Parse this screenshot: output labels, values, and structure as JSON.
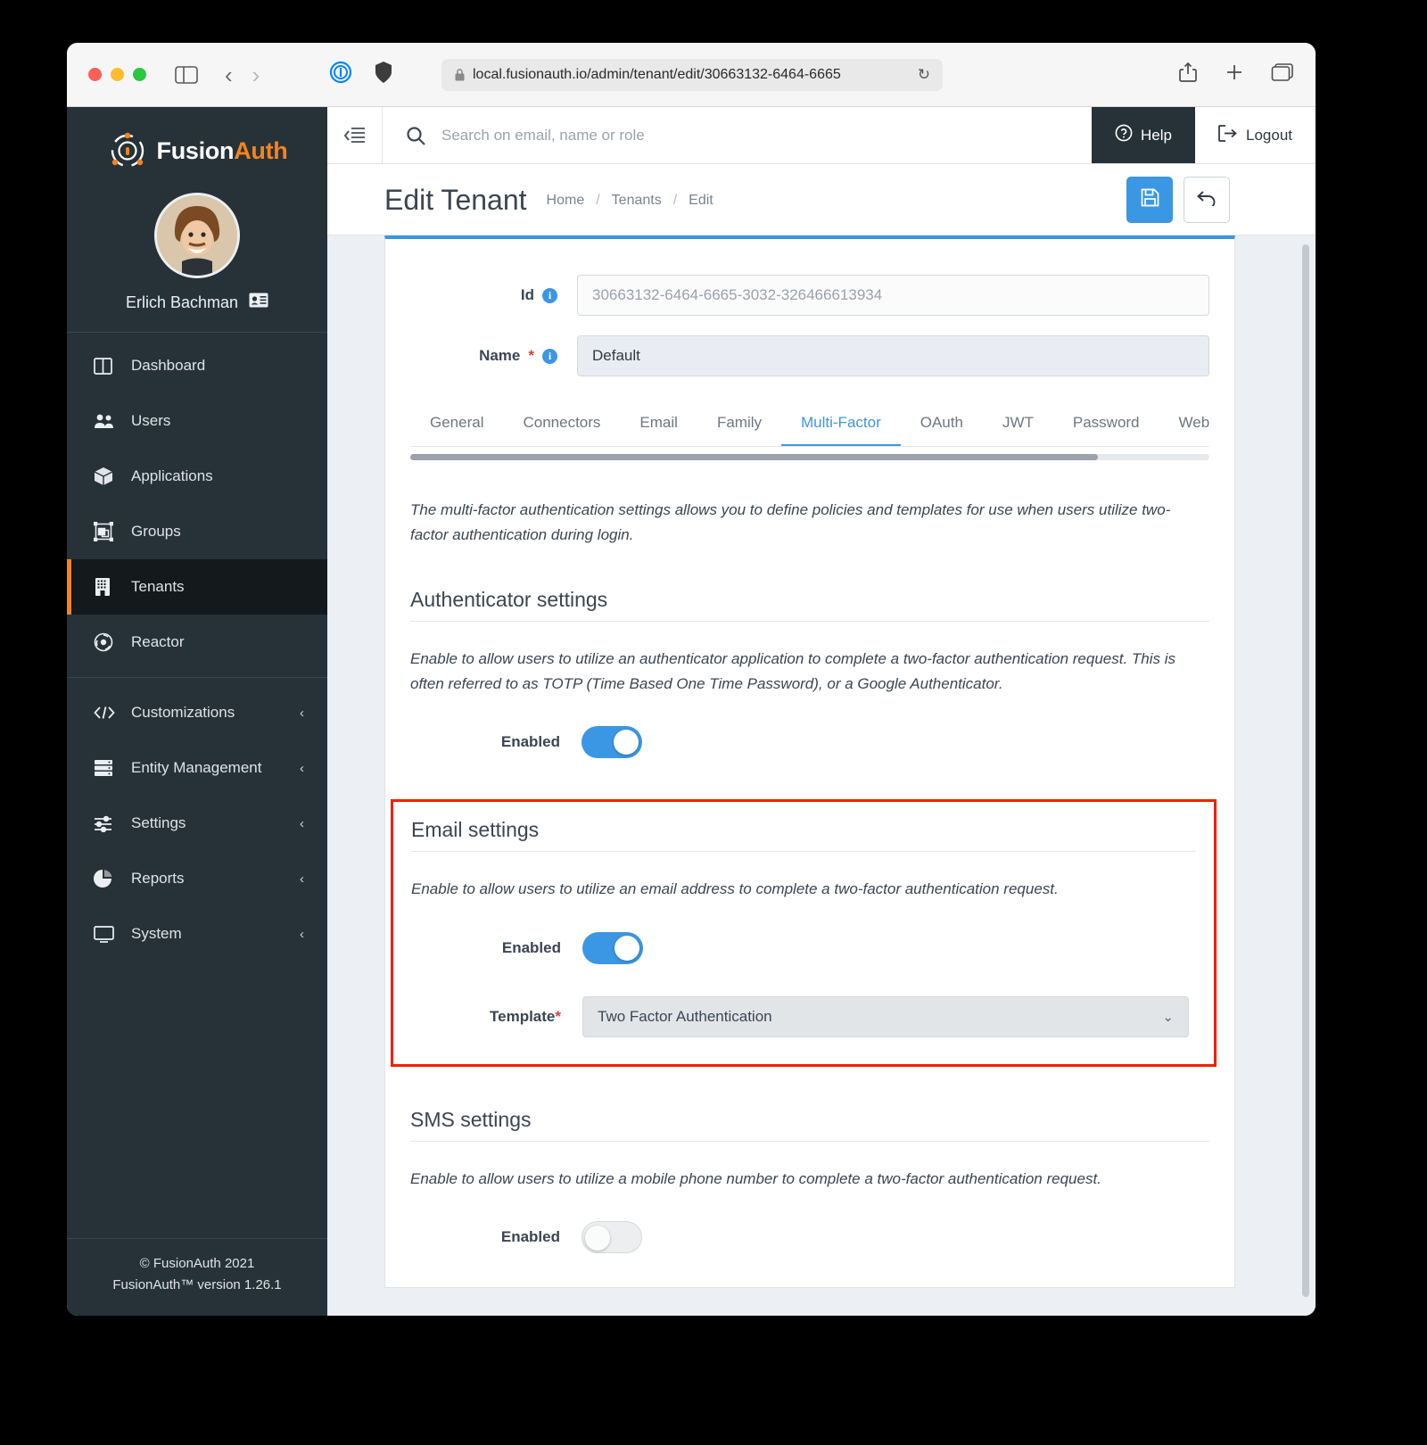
{
  "browser": {
    "url": "local.fusionauth.io/admin/tenant/edit/30663132-6464-6665",
    "lock_icon": "lock-icon",
    "reload_icon": "reload-icon",
    "share_icon": "share-icon",
    "newtab_icon": "plus-icon",
    "tabs_icon": "tabs-overview-icon",
    "back_icon": "chevron-left-icon",
    "forward_icon": "chevron-right-icon",
    "sidebar_icon": "sidebar-toggle-icon",
    "ext_1_icon": "1password-icon",
    "ext_2_icon": "shield-icon"
  },
  "sidebar": {
    "brand": {
      "first": "Fusion",
      "second": "Auth"
    },
    "user": {
      "name": "Erlich Bachman",
      "badge_icon": "id-card-icon"
    },
    "items": [
      {
        "label": "Dashboard",
        "icon": "dashboard-icon",
        "active": false,
        "chevron": ""
      },
      {
        "label": "Users",
        "icon": "users-icon",
        "active": false,
        "chevron": ""
      },
      {
        "label": "Applications",
        "icon": "cube-icon",
        "active": false,
        "chevron": ""
      },
      {
        "label": "Groups",
        "icon": "groups-icon",
        "active": false,
        "chevron": ""
      },
      {
        "label": "Tenants",
        "icon": "building-icon",
        "active": true,
        "chevron": ""
      },
      {
        "label": "Reactor",
        "icon": "reactor-icon",
        "active": false,
        "chevron": ""
      }
    ],
    "items2": [
      {
        "label": "Customizations",
        "icon": "code-icon",
        "chevron": "‹"
      },
      {
        "label": "Entity Management",
        "icon": "server-icon",
        "chevron": "‹"
      },
      {
        "label": "Settings",
        "icon": "sliders-icon",
        "chevron": "‹"
      },
      {
        "label": "Reports",
        "icon": "pie-chart-icon",
        "chevron": "‹"
      },
      {
        "label": "System",
        "icon": "monitor-icon",
        "chevron": "‹"
      }
    ],
    "footer_line1": "© FusionAuth 2021",
    "footer_line2": "FusionAuth™ version 1.26.1"
  },
  "topbar": {
    "collapse_icon": "collapse-menu-icon",
    "search_placeholder": "Search on email, name or role",
    "search_value": "",
    "search_icon": "search-icon",
    "help_label": "Help",
    "help_icon": "question-circle-icon",
    "logout_label": "Logout",
    "logout_icon": "logout-icon"
  },
  "page": {
    "title": "Edit Tenant",
    "breadcrumbs": [
      "Home",
      "Tenants",
      "Edit"
    ],
    "breadcrumb_sep": "/",
    "save_icon": "save-disk-icon",
    "back_icon": "undo-arrow-icon"
  },
  "form": {
    "id_label": "Id",
    "id_value": "30663132-6464-6665-3032-326466613934",
    "name_label": "Name",
    "name_required": "*",
    "name_value": "Default"
  },
  "tabs": [
    {
      "label": "General",
      "active": false
    },
    {
      "label": "Connectors",
      "active": false
    },
    {
      "label": "Email",
      "active": false
    },
    {
      "label": "Family",
      "active": false
    },
    {
      "label": "Multi-Factor",
      "active": true
    },
    {
      "label": "OAuth",
      "active": false
    },
    {
      "label": "JWT",
      "active": false
    },
    {
      "label": "Password",
      "active": false
    },
    {
      "label": "Webhooks",
      "active": false
    }
  ],
  "main": {
    "intro": "The multi-factor authentication settings allows you to define policies and templates for use when users utilize two-factor authentication during login.",
    "authenticator": {
      "title": "Authenticator settings",
      "description": "Enable to allow users to utilize an authenticator application to complete a two-factor authentication request. This is often referred to as TOTP (Time Based One Time Password), or a Google Authenticator.",
      "enabled_label": "Enabled",
      "enabled": true
    },
    "email": {
      "title": "Email settings",
      "description": "Enable to allow users to utilize an email address to complete a two-factor authentication request.",
      "enabled_label": "Enabled",
      "enabled": true,
      "template_label": "Template",
      "template_required": "*",
      "template_value": "Two Factor Authentication",
      "highlight_color": "#f51d00"
    },
    "sms": {
      "title": "SMS settings",
      "description": "Enable to allow users to utilize a mobile phone number to complete a two-factor authentication request.",
      "enabled_label": "Enabled",
      "enabled": false
    }
  },
  "colors": {
    "accent": "#3b97e3",
    "sidebar_bg": "#263238",
    "active_marker": "#f58320",
    "highlight": "#f51d00"
  }
}
